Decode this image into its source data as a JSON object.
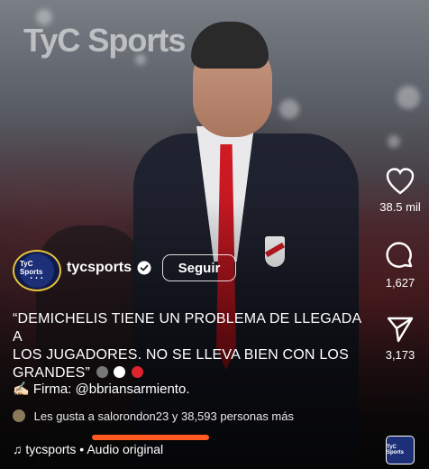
{
  "watermark": "TyC Sports",
  "actions": {
    "likes": "38.5 mil",
    "comments": "1,627",
    "shares": "3,173"
  },
  "author": {
    "avatar_text": "TyC Sports",
    "username": "tycsports",
    "follow_label": "Seguir"
  },
  "caption": {
    "line1": "“DEMICHELIS TIENE UN PROBLEMA DE LLEGADA A",
    "line2": "LOS JUGADORES. NO SE LLEVA BIEN CON LOS",
    "line3": "GRANDES”"
  },
  "firma": {
    "label": "Firma:",
    "handle": "@bbriansarmiento."
  },
  "likes_text": "Les gusta a salorondon23 y 38,593 personas más",
  "audio": {
    "author": "tycsports",
    "separator": "•",
    "label": "Audio original"
  },
  "thumb_text": "TyC Sports",
  "colors": {
    "follow_border": "#ffffff",
    "underline": "#ff5a1f",
    "avatar_ring": "#e7c23a",
    "tie": "#d01a24"
  }
}
